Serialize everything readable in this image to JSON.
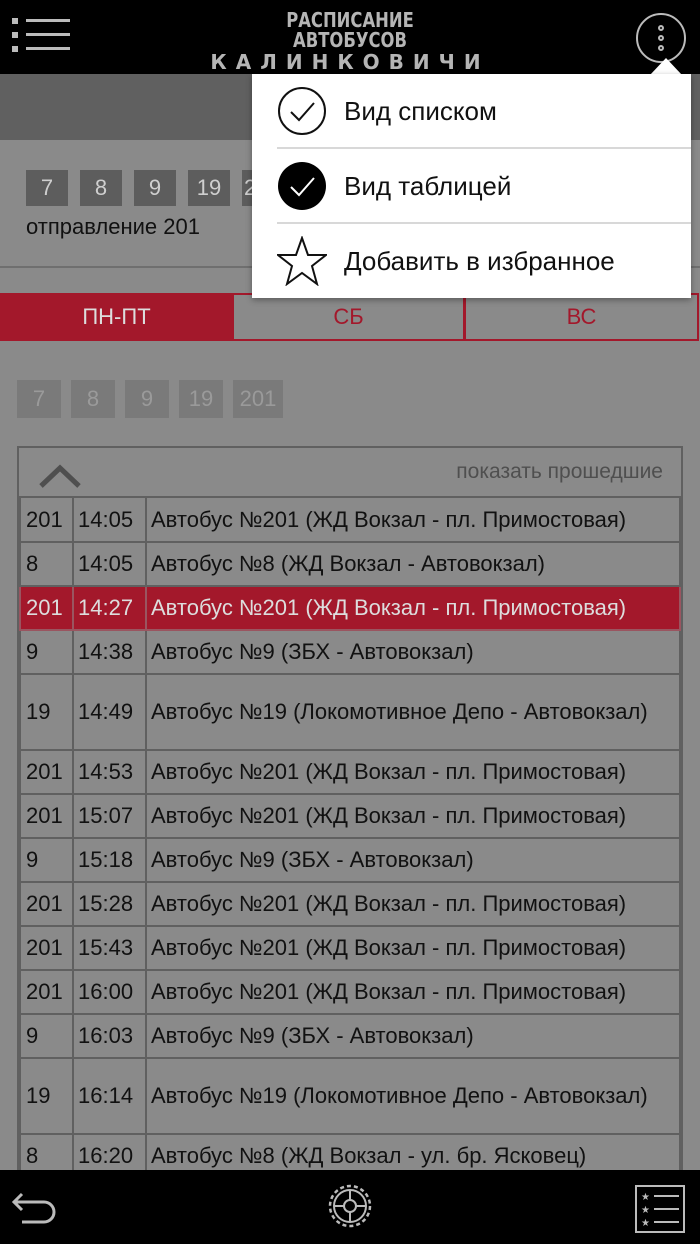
{
  "header": {
    "title_line1": "РАСПИСАНИЕ АВТОБУСОВ",
    "title_line2": "КАЛИНКОВИЧИ",
    "menu_icon": "hamburger-menu-icon",
    "more_icon": "vertical-dots-icon"
  },
  "filter_chips": [
    "7",
    "8",
    "9",
    "19"
  ],
  "partial_chip": "2",
  "direction_label": "отправление 201",
  "day_tabs": [
    {
      "label": "ПН-ПТ",
      "active": true
    },
    {
      "label": "СБ",
      "active": false
    },
    {
      "label": "ВС",
      "active": false
    }
  ],
  "route_chips": [
    "7",
    "8",
    "9",
    "19",
    "201"
  ],
  "schedule": {
    "show_past_label": "показать прошедшие",
    "rows": [
      {
        "route": "201",
        "time": "14:05",
        "desc": "Автобус №201 (ЖД Вокзал - пл. Примостовая)",
        "highlight": false
      },
      {
        "route": "8",
        "time": "14:05",
        "desc": "Автобус №8 (ЖД Вокзал - Автовокзал)",
        "highlight": false
      },
      {
        "route": "201",
        "time": "14:27",
        "desc": "Автобус №201 (ЖД Вокзал - пл. Примостовая)",
        "highlight": true
      },
      {
        "route": "9",
        "time": "14:38",
        "desc": "Автобус №9 (ЗБХ - Автовокзал)",
        "highlight": false
      },
      {
        "route": "19",
        "time": "14:49",
        "desc": "Автобус №19 (Локомотивное Депо - Автовокзал)",
        "highlight": false
      },
      {
        "route": "201",
        "time": "14:53",
        "desc": "Автобус №201 (ЖД Вокзал - пл. Примостовая)",
        "highlight": false
      },
      {
        "route": "201",
        "time": "15:07",
        "desc": "Автобус №201 (ЖД Вокзал - пл. Примостовая)",
        "highlight": false
      },
      {
        "route": "9",
        "time": "15:18",
        "desc": "Автобус №9 (ЗБХ - Автовокзал)",
        "highlight": false
      },
      {
        "route": "201",
        "time": "15:28",
        "desc": "Автобус №201 (ЖД Вокзал - пл. Примостовая)",
        "highlight": false
      },
      {
        "route": "201",
        "time": "15:43",
        "desc": "Автобус №201 (ЖД Вокзал - пл. Примостовая)",
        "highlight": false
      },
      {
        "route": "201",
        "time": "16:00",
        "desc": "Автобус №201 (ЖД Вокзал - пл. Примостовая)",
        "highlight": false
      },
      {
        "route": "9",
        "time": "16:03",
        "desc": "Автобус №9 (ЗБХ - Автовокзал)",
        "highlight": false
      },
      {
        "route": "19",
        "time": "16:14",
        "desc": "Автобус №19 (Локомотивное Депо - Автовокзал)",
        "highlight": false
      },
      {
        "route": "8",
        "time": "16:20",
        "desc": "Автобус №8 (ЖД Вокзал - ул. бр. Ясковец)",
        "highlight": false
      }
    ]
  },
  "dropdown": {
    "items": [
      {
        "label": "Вид списком",
        "icon": "check-outline-icon"
      },
      {
        "label": "Вид таблицей",
        "icon": "check-filled-icon"
      },
      {
        "label": "Добавить в избранное",
        "icon": "star-outline-icon"
      }
    ]
  },
  "bottombar": {
    "back_icon": "back-arrow-icon",
    "center_icon": "gear-wheel-icon",
    "right_icon": "starred-list-icon"
  },
  "colors": {
    "accent": "#a3182b",
    "bar": "#000000",
    "dim_bg": "#8a8a8a"
  }
}
